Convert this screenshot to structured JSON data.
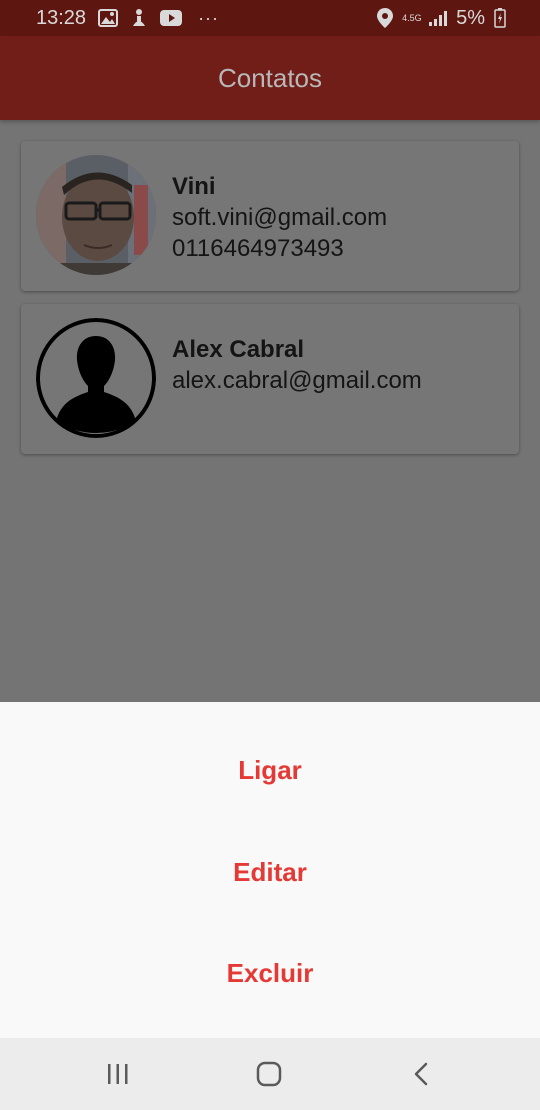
{
  "status_bar": {
    "time": "13:28",
    "network": "4.5G",
    "battery": "5%",
    "more": "···",
    "icons": [
      "image-icon",
      "notification-icon",
      "youtube-icon",
      "location-icon",
      "signal-icon",
      "battery-icon"
    ]
  },
  "app_bar": {
    "title": "Contatos"
  },
  "contacts": [
    {
      "name": "Vini",
      "email": "soft.vini@gmail.com",
      "phone": "0116464973493",
      "avatar": "photo"
    },
    {
      "name": "Alex Cabral",
      "email": "alex.cabral@gmail.com",
      "avatar": "person-silhouette-icon"
    }
  ],
  "bottom_sheet": {
    "options": [
      {
        "label": "Ligar"
      },
      {
        "label": "Editar"
      },
      {
        "label": "Excluir"
      }
    ],
    "accent_color": "#e53935"
  },
  "nav_bar": {
    "buttons": [
      "recent-apps-icon",
      "home-icon",
      "back-icon"
    ]
  },
  "colors": {
    "app_bar": "#711e19",
    "status_bar": "#5e1611",
    "scrim_background": "#747474",
    "sheet_background": "#f9f9f9"
  }
}
